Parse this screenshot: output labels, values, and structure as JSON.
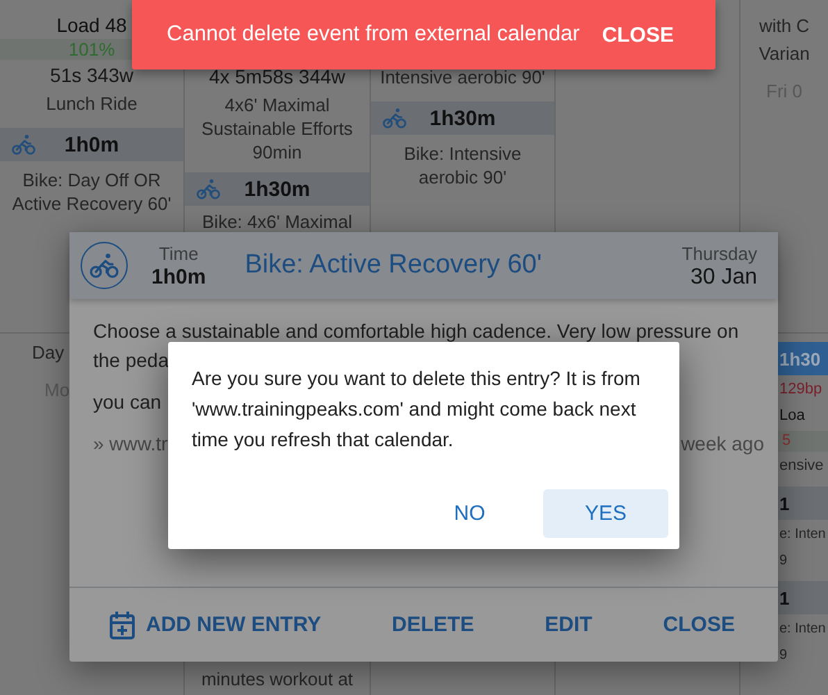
{
  "calendar": {
    "weeks": [
      {
        "days": [
          {
            "items": [
              {
                "kind": "stat",
                "text": "Load 48"
              },
              {
                "kind": "percent",
                "text": "101%",
                "color": "#2f6b2f"
              },
              {
                "kind": "metric",
                "text": "51s 343w"
              },
              {
                "kind": "name",
                "text": "Lunch Ride"
              },
              {
                "kind": "workout",
                "text": "1h0m",
                "highlighted": false
              },
              {
                "kind": "description",
                "text": "Bike: Day Off OR Active Recovery 60'"
              }
            ]
          },
          {
            "items": [
              {
                "kind": "metric",
                "text": "4x 5m58s 344w"
              },
              {
                "kind": "name",
                "text": "4x6' Maximal Sustainable Efforts 90min"
              },
              {
                "kind": "workout",
                "text": "1h30m",
                "highlighted": false
              },
              {
                "kind": "description",
                "text": "Bike: 4x6' Maximal"
              }
            ]
          },
          {
            "items": [
              {
                "kind": "name",
                "text": "Intensive aerobic 90'"
              },
              {
                "kind": "workout",
                "text": "1h30m",
                "highlighted": false
              },
              {
                "kind": "description",
                "text": "Bike: Intensive aerobic 90'"
              }
            ]
          },
          {
            "items": [
              {
                "kind": "name",
                "text": "with C"
              },
              {
                "kind": "name",
                "text": "Varian"
              },
              {
                "kind": "day",
                "text": "Fri 0"
              }
            ]
          }
        ]
      },
      {
        "days": [
          {
            "items": [
              {
                "kind": "name",
                "text": "Day"
              },
              {
                "kind": "day",
                "text": "Mo"
              }
            ]
          },
          {
            "items": [
              {
                "kind": "name",
                "text": "minutes workout at"
              }
            ]
          },
          {
            "items": [
              {
                "kind": "workout",
                "text": "1h30",
                "highlighted": true
              },
              {
                "kind": "hr",
                "text": "129bp",
                "color": "#7a1f2a"
              },
              {
                "kind": "stat",
                "text": "Loa"
              },
              {
                "kind": "percent",
                "text": "5",
                "color": "#8a3030"
              },
              {
                "kind": "name",
                "text": "ensive"
              },
              {
                "kind": "workout",
                "text": "1",
                "highlighted": false
              },
              {
                "kind": "description",
                "text": "e: Inten"
              },
              {
                "kind": "description",
                "text": "9"
              },
              {
                "kind": "workout",
                "text": "1",
                "highlighted": false
              },
              {
                "kind": "description",
                "text": "e: Inten"
              },
              {
                "kind": "description",
                "text": "9"
              }
            ]
          }
        ]
      }
    ]
  },
  "event_dialog": {
    "time_label": "Time",
    "time": "1h0m",
    "title": "Bike: Active Recovery 60'",
    "weekday": "Thursday",
    "date": "30 Jan",
    "description": [
      "Choose a sustainable and comfortable high cadence. Very low pressure on",
      "the peda",
      "you can"
    ],
    "source_link": "» www.tr",
    "updated": "week ago",
    "actions": [
      {
        "label": "ADD NEW ENTRY",
        "kind": "add"
      },
      {
        "label": "DELETE",
        "kind": "plain"
      },
      {
        "label": "EDIT",
        "kind": "plain"
      },
      {
        "label": "CLOSE",
        "kind": "plain"
      }
    ]
  },
  "confirm_dialog": {
    "message": "Are you sure you want to delete this entry? It is from 'www.trainingpeaks.com' and might come back next time you refresh that calendar.",
    "buttons": [
      {
        "label": "NO",
        "focused": false
      },
      {
        "label": "YES",
        "focused": true
      }
    ]
  },
  "snackbar": {
    "message": "Cannot delete event from external calendar",
    "action": "CLOSE"
  }
}
